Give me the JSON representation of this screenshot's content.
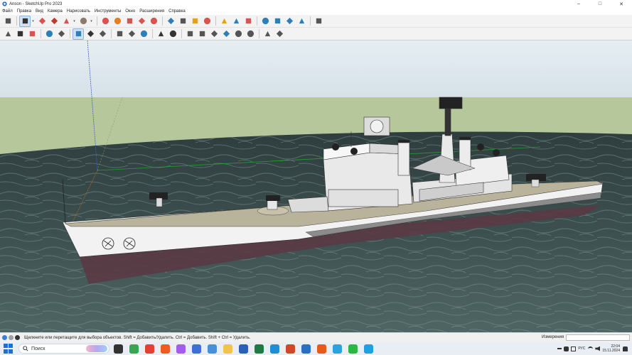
{
  "window": {
    "title": "Anson - SketchUp Pro 2023",
    "controls": {
      "minimize": "–",
      "maximize": "□",
      "close": "✕"
    }
  },
  "menu": [
    "Файл",
    "Правка",
    "Вид",
    "Камера",
    "Нарисовать",
    "Инструменты",
    "Окно",
    "Расширения",
    "Справка"
  ],
  "toolbar_main": [
    {
      "name": "zoom-icon",
      "color": "#555555"
    },
    {
      "name": "select-arrow-icon",
      "color": "#333333",
      "active": true
    },
    {
      "name": "eraser-icon",
      "color": "#d9534f"
    },
    {
      "name": "pencil-icon",
      "color": "#c0392b"
    },
    {
      "name": "arc-icon",
      "color": "#d9534f"
    },
    {
      "name": "rectangle-icon",
      "color": "#8c7b6b"
    },
    {
      "name": "push-pull-icon",
      "color": "#d9534f"
    },
    {
      "name": "follow-me-icon",
      "color": "#e67e22"
    },
    {
      "name": "move-icon",
      "color": "#d9534f"
    },
    {
      "name": "rotate-icon",
      "color": "#d9534f"
    },
    {
      "name": "scale-icon",
      "color": "#d9534f"
    },
    {
      "name": "offset-icon",
      "color": "#2c7fb8"
    },
    {
      "name": "tape-measure-icon",
      "color": "#555555"
    },
    {
      "name": "paint-bucket-icon",
      "color": "#e6a117"
    },
    {
      "name": "orbit-icon",
      "color": "#d9534f"
    },
    {
      "name": "pan-icon",
      "color": "#e6a117"
    },
    {
      "name": "zoom-window-icon",
      "color": "#2c7fb8"
    },
    {
      "name": "zoom-extents-icon",
      "color": "#d9534f"
    },
    {
      "name": "section-plane-icon",
      "color": "#2c7fb8"
    },
    {
      "name": "section-fill-icon",
      "color": "#2c7fb8"
    },
    {
      "name": "layers-icon",
      "color": "#2c7fb8"
    },
    {
      "name": "solid-tools-icon",
      "color": "#2c7fb8"
    },
    {
      "name": "user-account-icon",
      "color": "#555555"
    }
  ],
  "toolbar_secondary": [
    {
      "name": "open-folder-icon",
      "color": "#555555"
    },
    {
      "name": "gear-icon",
      "color": "#333333"
    },
    {
      "name": "no-entry-icon",
      "color": "#d9534f"
    },
    {
      "name": "materials-icon",
      "color": "#2c7fb8"
    },
    {
      "name": "components-icon",
      "color": "#555555"
    },
    {
      "name": "xray-icon",
      "color": "#2c7fb8",
      "active": true
    },
    {
      "name": "back-edges-icon",
      "color": "#333333"
    },
    {
      "name": "shaded-icon",
      "color": "#555555"
    },
    {
      "name": "cloud-upload-icon",
      "color": "#555555"
    },
    {
      "name": "cloud-download-icon",
      "color": "#555555"
    },
    {
      "name": "warehouse-icon",
      "color": "#2c7fb8"
    },
    {
      "name": "dot-icon",
      "color": "#333333"
    },
    {
      "name": "dimension-icon",
      "color": "#333333"
    },
    {
      "name": "iso-view-icon",
      "color": "#555555"
    },
    {
      "name": "top-view-icon",
      "color": "#555555"
    },
    {
      "name": "front-view-icon",
      "color": "#555555"
    },
    {
      "name": "right-view-icon",
      "color": "#2c7fb8"
    },
    {
      "name": "back-view-icon",
      "color": "#555555"
    },
    {
      "name": "left-view-icon",
      "color": "#555555"
    },
    {
      "name": "cloud-share-icon",
      "color": "#555555"
    },
    {
      "name": "cloud-sync-icon",
      "color": "#555555"
    }
  ],
  "viewport": {
    "sky_color": "#dbe6ec",
    "ground_color": "#b6c79b",
    "water_color": "#3a4a4a",
    "ship_hull_color": "#f2f2f2",
    "ship_deck_color": "#b9b39b",
    "waterline_color": "#5a3944"
  },
  "status": {
    "hint": "Щелкните или перетащите для выбора объектов. Shift = Добавить/Удалить. Ctrl = Добавить. Shift + Ctrl = Удалить.",
    "measure_label": "Измерения",
    "measure_value": ""
  },
  "taskbar": {
    "search_label": "Поиск",
    "apps": [
      {
        "name": "task-view-icon",
        "color": "#333333"
      },
      {
        "name": "green-app-icon",
        "color": "#3aa655"
      },
      {
        "name": "chrome-icon",
        "color": "#e44134"
      },
      {
        "name": "brave-icon",
        "color": "#f25a24"
      },
      {
        "name": "media-app-icon",
        "color": "#a45cf0"
      },
      {
        "name": "image-app-icon",
        "color": "#3d6fd6"
      },
      {
        "name": "sketch-app-icon",
        "color": "#4a90d9"
      },
      {
        "name": "file-explorer-icon",
        "color": "#f2c24a"
      },
      {
        "name": "word-icon",
        "color": "#2b5fb8"
      },
      {
        "name": "excel-icon",
        "color": "#1f7a45"
      },
      {
        "name": "edge-icon",
        "color": "#1e8fd6"
      },
      {
        "name": "powerpoint-icon",
        "color": "#d24726"
      },
      {
        "name": "sketchup-taskbar-icon",
        "color": "#2c6fc2"
      },
      {
        "name": "firefox-icon",
        "color": "#e8591a"
      },
      {
        "name": "telegram-icon",
        "color": "#2aa3df"
      },
      {
        "name": "whatsapp-icon",
        "color": "#2bb741"
      },
      {
        "name": "skype-icon",
        "color": "#1da1e1"
      }
    ],
    "tray": {
      "lang": "РУС",
      "time": "22:04",
      "date": "15.11.2024"
    }
  }
}
